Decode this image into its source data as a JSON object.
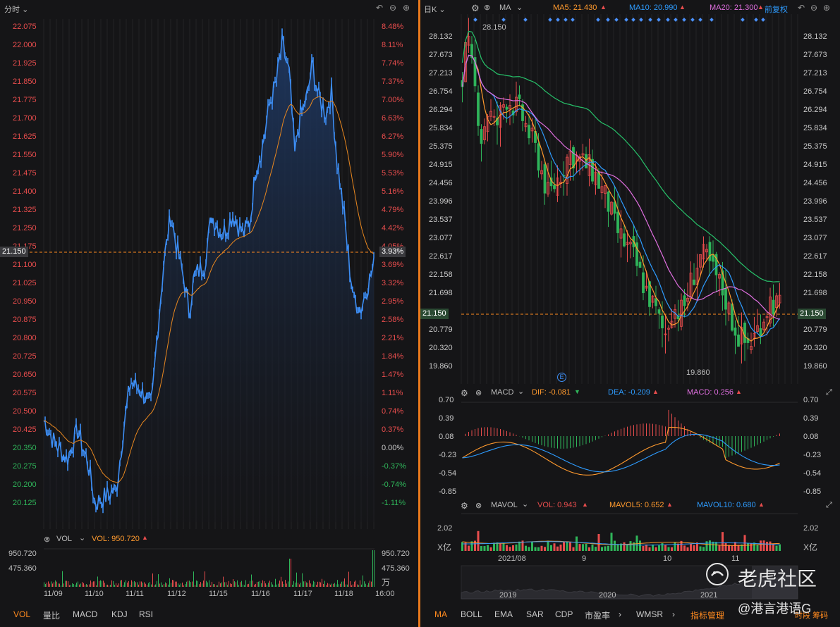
{
  "left": {
    "period_label": "分时",
    "price_ticks": [
      "22.075",
      "22.000",
      "21.925",
      "21.850",
      "21.775",
      "21.700",
      "21.625",
      "21.550",
      "21.475",
      "21.400",
      "21.325",
      "21.250",
      "21.175",
      "21.150",
      "21.100",
      "21.025",
      "20.950",
      "20.875",
      "20.800",
      "20.725",
      "20.650",
      "20.575",
      "20.500",
      "20.425",
      "20.350",
      "20.275",
      "20.200",
      "20.125"
    ],
    "pct_ticks": [
      "8.48%",
      "8.11%",
      "7.74%",
      "7.37%",
      "7.00%",
      "6.63%",
      "6.27%",
      "5.90%",
      "5.53%",
      "5.16%",
      "4.79%",
      "4.42%",
      "4.05%",
      "3.93%",
      "3.69%",
      "3.32%",
      "2.95%",
      "2.58%",
      "2.21%",
      "1.84%",
      "1.47%",
      "1.11%",
      "0.74%",
      "0.37%",
      "0.00%",
      "-0.37%",
      "-0.74%",
      "-1.11%"
    ],
    "current_price": "21.150",
    "current_pct": "3.93%",
    "vol_label": "VOL",
    "vol_value": "VOL: 950.720",
    "vol_ticks": [
      "950.720",
      "475.360"
    ],
    "vol_unit": "万",
    "date_labels": [
      "11/09",
      "11/10",
      "11/11",
      "11/12",
      "11/15",
      "11/16",
      "11/17",
      "11/18",
      "16:00"
    ],
    "tabs": [
      "VOL",
      "量比",
      "MACD",
      "KDJ",
      "RSI"
    ]
  },
  "right": {
    "period_label": "日K",
    "ma_label": "MA",
    "ma5": "MA5: 21.430",
    "ma10": "MA10: 20.990",
    "ma20": "MA20: 21.300",
    "adjust": "前复权",
    "price_ticks": [
      "28.132",
      "27.673",
      "27.213",
      "26.754",
      "26.294",
      "25.834",
      "25.375",
      "24.915",
      "24.456",
      "23.996",
      "23.537",
      "23.077",
      "22.617",
      "22.158",
      "21.698",
      "21.150",
      "20.779",
      "20.320",
      "19.860"
    ],
    "current_price": "21.150",
    "high_note": "28.150",
    "low_note": "19.860",
    "event_marker": "E",
    "macd_label": "MACD",
    "dif": "DIF: -0.081",
    "dea": "DEA: -0.209",
    "macd": "MACD: 0.256",
    "macd_ticks": [
      "0.70",
      "0.39",
      "0.08",
      "-0.23",
      "-0.54",
      "-0.85"
    ],
    "mavol_label": "MAVOL",
    "vol": "VOL: 0.943",
    "mavol5": "MAVOL5: 0.652",
    "mavol10": "MAVOL10: 0.680",
    "vol_ticks": [
      "2.02",
      "X亿"
    ],
    "date_labels": [
      "2021/08",
      "9",
      "10",
      "11"
    ],
    "overview_years": [
      "2019",
      "2020",
      "2021"
    ],
    "tabs": [
      "MA",
      "BOLL",
      "EMA",
      "SAR",
      "CDP",
      "市盈率",
      "WMSR",
      "指标管理"
    ],
    "tab_arrow": "›",
    "watermark_brand": "老虎社区",
    "watermark_user": "@港言港语G",
    "corner_text": "时段 筹码"
  },
  "colors": {
    "up": "#e84d4d",
    "down": "#2fb55a",
    "line": "#3d8ef5",
    "ma5": "#ff9a2e",
    "ma10": "#2e9cff",
    "ma20": "#e06fe0",
    "ma60": "#27c26a",
    "accent": "#ff8a1f"
  },
  "chart_data": [
    {
      "type": "line",
      "title": "分时",
      "x": [
        "11/09",
        "11/10",
        "11/11",
        "11/12",
        "11/15",
        "11/16",
        "11/17",
        "11/18"
      ],
      "series": [
        {
          "name": "price",
          "values": [
            20.4,
            20.17,
            20.55,
            21.1,
            21.3,
            21.8,
            21.75,
            21.15
          ]
        }
      ],
      "ylim": [
        20.1,
        22.1
      ]
    },
    {
      "type": "bar",
      "title": "日K",
      "categories": [
        "2021/08",
        "9",
        "10",
        "11"
      ],
      "series": [
        {
          "name": "MA5",
          "values": [
            27.0,
            25.2,
            21.9,
            21.43
          ]
        },
        {
          "name": "MA10",
          "values": [
            26.8,
            25.0,
            22.3,
            20.99
          ]
        },
        {
          "name": "MA20",
          "values": [
            26.9,
            25.1,
            23.0,
            21.3
          ]
        }
      ],
      "ylim": [
        19.86,
        28.15
      ]
    }
  ]
}
